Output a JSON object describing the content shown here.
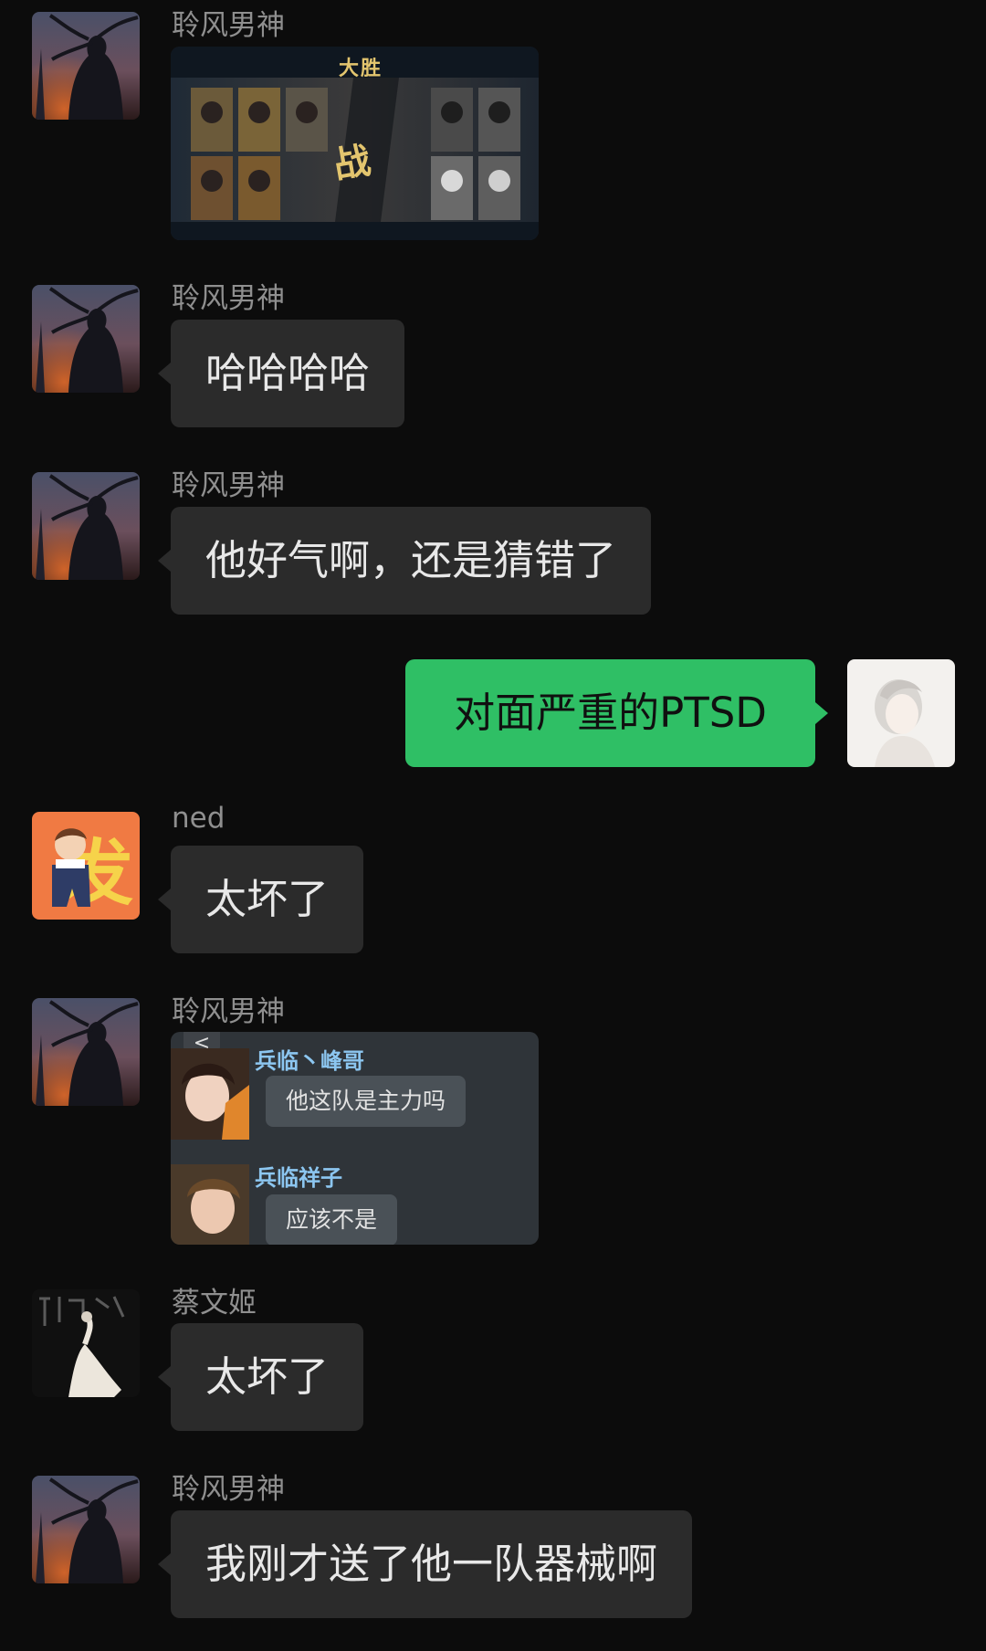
{
  "messages": [
    {
      "sender": "聆风男神",
      "type": "image",
      "image": "game-battle-screenshot",
      "game": {
        "title": "大胜",
        "center_text": "战"
      }
    },
    {
      "sender": "聆风男神",
      "type": "text",
      "text": "哈哈哈哈"
    },
    {
      "sender": "聆风男神",
      "type": "text",
      "text": "他好气啊，还是猜错了"
    },
    {
      "sender": "me",
      "type": "text",
      "text": "对面严重的PTSD"
    },
    {
      "sender": "ned",
      "type": "text",
      "text": "太坏了"
    },
    {
      "sender": "聆风男神",
      "type": "image",
      "image": "chat-screenshot",
      "chat": {
        "back_icon": "<",
        "msgs": [
          {
            "name": "兵临丶峰哥",
            "text": "他这队是主力吗"
          },
          {
            "name": "兵临祥子",
            "text": "应该不是"
          }
        ]
      }
    },
    {
      "sender": "蔡文姬",
      "type": "text",
      "text": "太坏了"
    },
    {
      "sender": "聆风男神",
      "type": "text",
      "text": "我刚才送了他一队器械啊"
    }
  ],
  "colors": {
    "background": "#0c0c0c",
    "bubble_other": "#2b2b2b",
    "bubble_self": "#2fbf65",
    "sender_name": "#8f8f8f"
  }
}
